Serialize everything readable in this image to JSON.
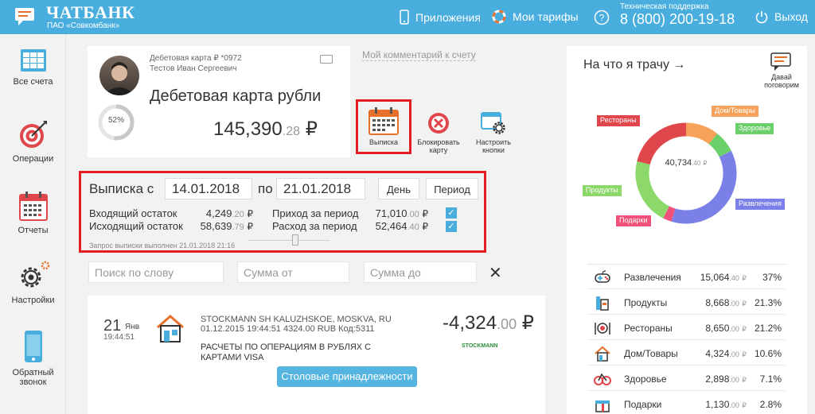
{
  "header": {
    "brand": "ЧАТБАНК",
    "brand_sub": "ПАО «Совкомбанк»",
    "nav_apps": "Приложения",
    "nav_tariffs": "Мои тарифы",
    "support_label": "Техническая поддержка",
    "support_phone": "8 (800) 200-19-18",
    "exit": "Выход"
  },
  "sidebar": {
    "items": [
      {
        "label": "Все счета",
        "icon": "accounts-grid-icon"
      },
      {
        "label": "Операции",
        "icon": "target-icon"
      },
      {
        "label": "Отчеты",
        "icon": "calendar-icon"
      },
      {
        "label": "Настройки",
        "icon": "gear-icon"
      },
      {
        "label": "Обратный звонок",
        "icon": "phone-icon"
      }
    ]
  },
  "account": {
    "card_number": "Дебетовая карта ₽ *0972",
    "holder": "Тестов Иван Сергеевич",
    "title": "Дебетовая карта рубли",
    "progress_label": "52%",
    "progress_value": 0.52,
    "balance_main": "145,390",
    "balance_fraction": ".28",
    "currency": "₽",
    "comment_link": "Мой комментарий к счету"
  },
  "actions": {
    "statement": "Выписка",
    "block": "Блокировать карту",
    "configure": "Настроить кнопки"
  },
  "statement": {
    "from_label": "Выписка с",
    "date_from": "14.01.2018",
    "to_label": "по",
    "date_to": "21.01.2018",
    "day_btn": "День",
    "period_btn": "Период",
    "opening_label": "Входящий остаток",
    "opening_main": "4,249",
    "opening_frac": ".20",
    "closing_label": "Исходящий остаток",
    "closing_main": "58,639",
    "closing_frac": ".79",
    "income_label": "Приход за период",
    "income_main": "71,010",
    "income_frac": ".00",
    "expense_label": "Расход за период",
    "expense_main": "52,464",
    "expense_frac": ".40",
    "currency": "₽",
    "footer": "Запрос выписки выполнен 21.01.2018 21:16"
  },
  "filters": {
    "search_placeholder": "Поиск по слову",
    "sum_from_placeholder": "Сумма от",
    "sum_to_placeholder": "Сумма до"
  },
  "transaction": {
    "day": "21",
    "month": "Янв",
    "time": "19:44:51",
    "desc_line1": "STOCKMANN SH KALUZHSKOE, MOSKVA, RU",
    "desc_line2": "01.12.2015 19:44:51 4324.00 RUB Код:5311",
    "note_line1": "РАСЧЕТЫ ПО ОПЕРАЦИЯМ В РУБЛЯХ С",
    "note_line2": "КАРТАМИ VISA",
    "amount_main": "-4,324",
    "amount_frac": ".00",
    "currency": "₽",
    "brand": "STOCKMANN",
    "category": "Столовые принадлежности"
  },
  "spending": {
    "title": "На что я трачу →",
    "help": "Давай поговорим",
    "total_main": "40,734",
    "total_frac": ".40",
    "currency": "₽",
    "categories": [
      {
        "name": "Развлечения",
        "main": "15,064",
        "frac": ".40",
        "pct": "37%",
        "color": "#7b7fe8",
        "icon": "gamepad-icon"
      },
      {
        "name": "Продукты",
        "main": "8,668",
        "frac": ".00",
        "pct": "21.3%",
        "color": "#8cd86a",
        "icon": "groceries-icon"
      },
      {
        "name": "Рестораны",
        "main": "8,650",
        "frac": ".00",
        "pct": "21.2%",
        "color": "#e0474c",
        "icon": "restaurant-icon"
      },
      {
        "name": "Дом/Товары",
        "main": "4,324",
        "frac": ".00",
        "pct": "10.6%",
        "color": "#f6a25a",
        "icon": "house-icon"
      },
      {
        "name": "Здоровье",
        "main": "2,898",
        "frac": ".00",
        "pct": "7.1%",
        "color": "#6cd06a",
        "icon": "health-icon"
      },
      {
        "name": "Подарки",
        "main": "1,130",
        "frac": ".00",
        "pct": "2.8%",
        "color": "#f0517a",
        "icon": "gift-icon"
      }
    ]
  }
}
